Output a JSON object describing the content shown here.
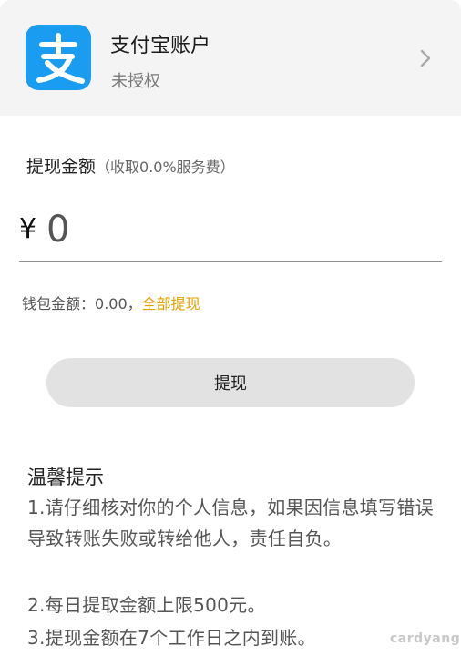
{
  "account": {
    "logo_icon": "alipay-logo-icon",
    "logo_color": "#1a9cf0",
    "name": "支付宝账户",
    "status": "未授权"
  },
  "withdraw": {
    "title": "提现金额",
    "fee_note": "（收取0.0%服务费）",
    "currency_symbol": "¥",
    "amount_placeholder": "0"
  },
  "balance": {
    "label": "钱包金额：",
    "value": "0.00，",
    "withdraw_all": "全部提现",
    "accent_color": "#e0a000"
  },
  "button": {
    "label": "提现"
  },
  "tips": {
    "title": "温馨提示",
    "items": [
      "1.请仔细核对你的个人信息，如果因信息填写错误导致转账失败或转给他人，责任自负。",
      "2.每日提取金额上限500元。",
      "3.提现金额在7个工作日之内到账。"
    ]
  },
  "watermark": "cardyang"
}
